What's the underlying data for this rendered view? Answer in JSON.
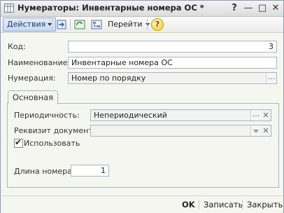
{
  "window": {
    "title": "Нумераторы: Инвентарные номера ОС *",
    "controls": {
      "help": "?",
      "minimize": "—",
      "maximize": "□",
      "close": "✕"
    }
  },
  "toolbar": {
    "actions_label": "Действия",
    "go_label": "Перейти",
    "help_label": "?"
  },
  "form": {
    "code_label": "Код:",
    "code_value": "3",
    "name_label": "Наименование:",
    "name_value": "Инвентарные номера ОС",
    "numbering_label": "Нумерация:",
    "numbering_value": "Номер по порядку",
    "dots": "..."
  },
  "tab": {
    "label": "Основная",
    "periodicity_label": "Периодичность:",
    "periodicity_value": "Непериодический",
    "doc_attr_label": "Реквизит документа:",
    "doc_attr_value": "",
    "use_label": "Использовать",
    "use_checked": true,
    "length_label": "Длина номера:",
    "length_value": "1"
  },
  "footer": {
    "ok_label": "OK",
    "save_label": "Записать",
    "close_label": "Закрыть"
  }
}
